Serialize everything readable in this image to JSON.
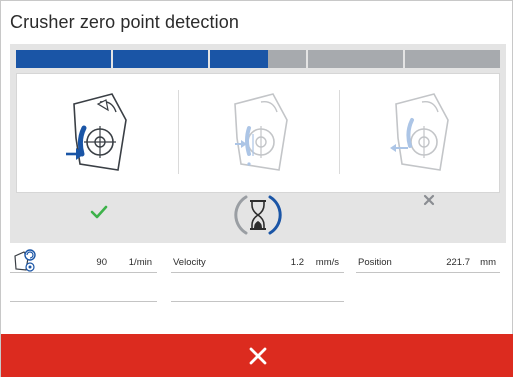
{
  "dialog": {
    "title": "Crusher zero point detection"
  },
  "progress": {
    "segments": [
      "done",
      "done",
      "partial",
      "todo",
      "todo"
    ],
    "partial_fraction": 0.6,
    "done_color": "#1a55a6",
    "todo_color": "#a7aaae"
  },
  "steps": [
    {
      "name": "step-1",
      "icon": "crusher-move-in-icon",
      "state": "completed",
      "status_icon": "checkmark-icon"
    },
    {
      "name": "step-2",
      "icon": "crusher-zero-contact-icon",
      "state": "in-progress",
      "status_icon": "hourglass-icon"
    },
    {
      "name": "step-3",
      "icon": "crusher-move-out-icon",
      "state": "pending",
      "status_icon": "cross-icon"
    }
  ],
  "readouts": {
    "speed": {
      "icon": "crusher-speed-icon",
      "value": "90",
      "unit": "1/min"
    },
    "velocity": {
      "label": "Velocity",
      "value": "1.2",
      "unit": "mm/s"
    },
    "position": {
      "label": "Position",
      "value": "221.7",
      "unit": "mm"
    }
  },
  "footer": {
    "cancel_icon": "close-icon",
    "color": "#dc2b1f"
  }
}
